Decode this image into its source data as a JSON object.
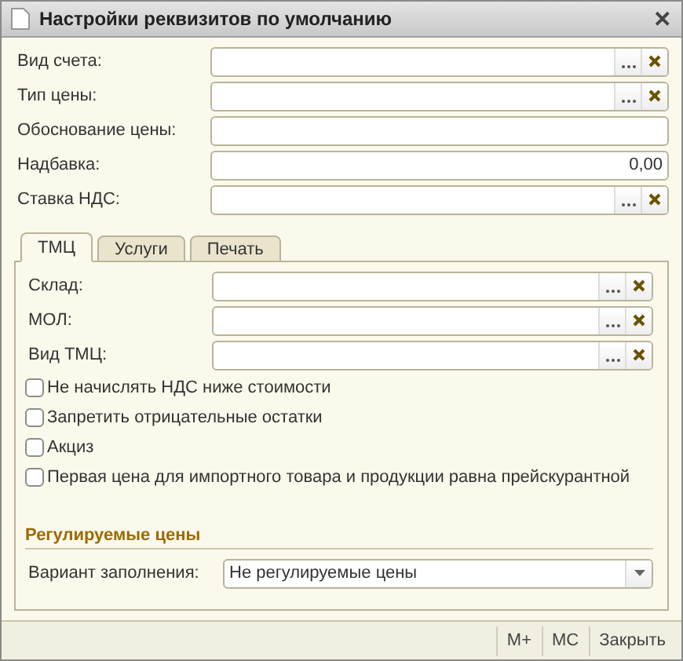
{
  "window": {
    "title": "Настройки реквизитов по умолчанию",
    "close": "✕"
  },
  "fields": [
    {
      "label": "Вид счета:",
      "kind": "choice"
    },
    {
      "label": "Тип цены:",
      "kind": "choice"
    },
    {
      "label": "Обоснование цены:",
      "kind": "text"
    },
    {
      "label": "Надбавка:",
      "kind": "number",
      "value": "0,00"
    },
    {
      "label": "Ставка НДС:",
      "kind": "choice"
    }
  ],
  "tabs": [
    {
      "label": "ТМЦ",
      "selected": true
    },
    {
      "label": "Услуги",
      "selected": false
    },
    {
      "label": "Печать",
      "selected": false
    }
  ],
  "tab_fields": [
    {
      "label": "Склад:",
      "kind": "choice"
    },
    {
      "label": "МОЛ:",
      "kind": "choice"
    },
    {
      "label": "Вид ТМЦ:",
      "kind": "choice"
    }
  ],
  "checkboxes": [
    {
      "label": "Не начислять НДС ниже стоимости",
      "checked": false
    },
    {
      "label": "Запретить отрицательные остатки",
      "checked": false
    },
    {
      "label": "Акциз",
      "checked": false
    },
    {
      "label": "Первая цена для импортного товара и продукции равна прейскурантной",
      "checked": false
    }
  ],
  "section": {
    "title": "Регулируемые цены",
    "label": "Вариант заполнения:",
    "value": "Не регулируемые цены"
  },
  "footer_buttons": [
    "M+",
    "MC",
    "Закрыть"
  ]
}
